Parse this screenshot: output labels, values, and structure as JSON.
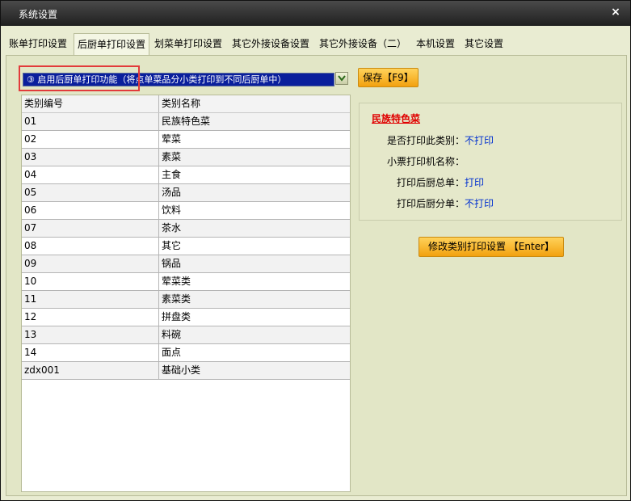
{
  "window": {
    "title": "系统设置",
    "close_glyph": "×"
  },
  "tabs": [
    {
      "label": "账单打印设置"
    },
    {
      "label": "后厨单打印设置"
    },
    {
      "label": "划菜单打印设置"
    },
    {
      "label": "其它外接设备设置"
    },
    {
      "label": "其它外接设备（二）"
    },
    {
      "label": "本机设置"
    },
    {
      "label": "其它设置"
    }
  ],
  "active_tab": 1,
  "kitchen_print": {
    "mode_select_value": "③ 启用后厨单打印功能（将点单菜品分小类打印到不同后厨单中）",
    "save_label": "保存【F9】"
  },
  "table": {
    "headers": [
      "类别编号",
      "类别名称"
    ],
    "rows": [
      [
        "01",
        "民族特色菜"
      ],
      [
        "02",
        "荤菜"
      ],
      [
        "03",
        "素菜"
      ],
      [
        "04",
        "主食"
      ],
      [
        "05",
        "汤品"
      ],
      [
        "06",
        "饮料"
      ],
      [
        "07",
        "茶水"
      ],
      [
        "08",
        "其它"
      ],
      [
        "09",
        "锅品"
      ],
      [
        "10",
        "荤菜类"
      ],
      [
        "11",
        "素菜类"
      ],
      [
        "12",
        "拼盘类"
      ],
      [
        "13",
        "料碗"
      ],
      [
        "14",
        "面点"
      ],
      [
        "zdx001",
        "基础小类"
      ]
    ]
  },
  "detail": {
    "title": "民族特色菜",
    "print_category_label": "是否打印此类别：",
    "print_category_value": "不打印",
    "printer_name_label": "小票打印机名称：",
    "kitchen_total_label": "打印后厨总单：",
    "kitchen_total_value": "打印",
    "kitchen_sub_label": "打印后厨分单：",
    "kitchen_sub_value": "不打印",
    "modify_label": "修改类别打印设置 【Enter】"
  },
  "colors": {
    "title_bar": "#2a2a2a",
    "panel_bg": "#e2e6c6",
    "accent_orange": "#f5b01e",
    "select_bg": "#0a1f9c",
    "value_blue": "#0030d0",
    "title_red": "#e00000"
  }
}
